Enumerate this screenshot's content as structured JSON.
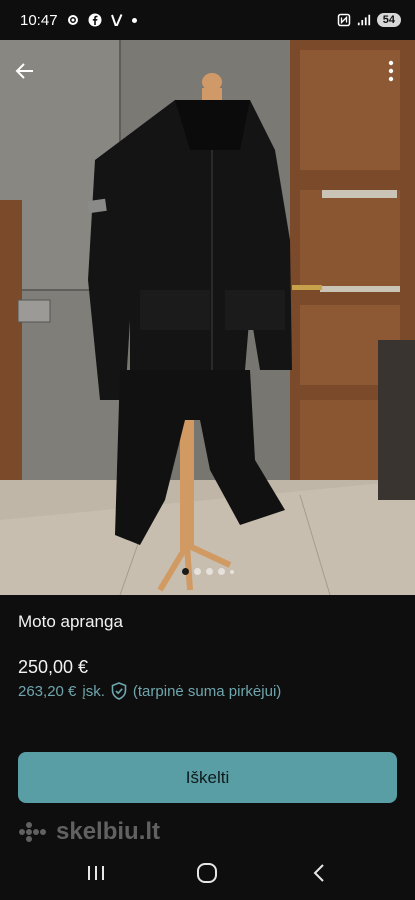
{
  "status_bar": {
    "time": "10:47",
    "battery": "54",
    "icons": [
      "settings-icon",
      "facebook-icon",
      "vinted-icon",
      "notification-dot-icon",
      "nfc-icon",
      "signal-icon",
      "battery-icon"
    ]
  },
  "header": {
    "back_icon": "arrow-left-icon",
    "more_icon": "more-vertical-icon"
  },
  "gallery": {
    "image_alt": "Moto apranga",
    "image_count": 5,
    "active_index": 0
  },
  "listing": {
    "title": "Moto apranga",
    "price": "250,00 €",
    "buyer_price": "263,20 €",
    "buyer_price_suffix": "įsk.",
    "buyer_note": "(tarpinė suma pirkėjui)"
  },
  "actions": {
    "primary_label": "Iškelti"
  },
  "branding": {
    "logo_text": "skelbiu.lt"
  },
  "colors": {
    "accent": "#5a9ea5",
    "buyer_price": "#6fa6ad",
    "background": "#0e0e0e"
  },
  "system_nav": {
    "recents_icon": "recents-icon",
    "home_icon": "home-icon",
    "back_icon": "back-chevron-icon"
  }
}
